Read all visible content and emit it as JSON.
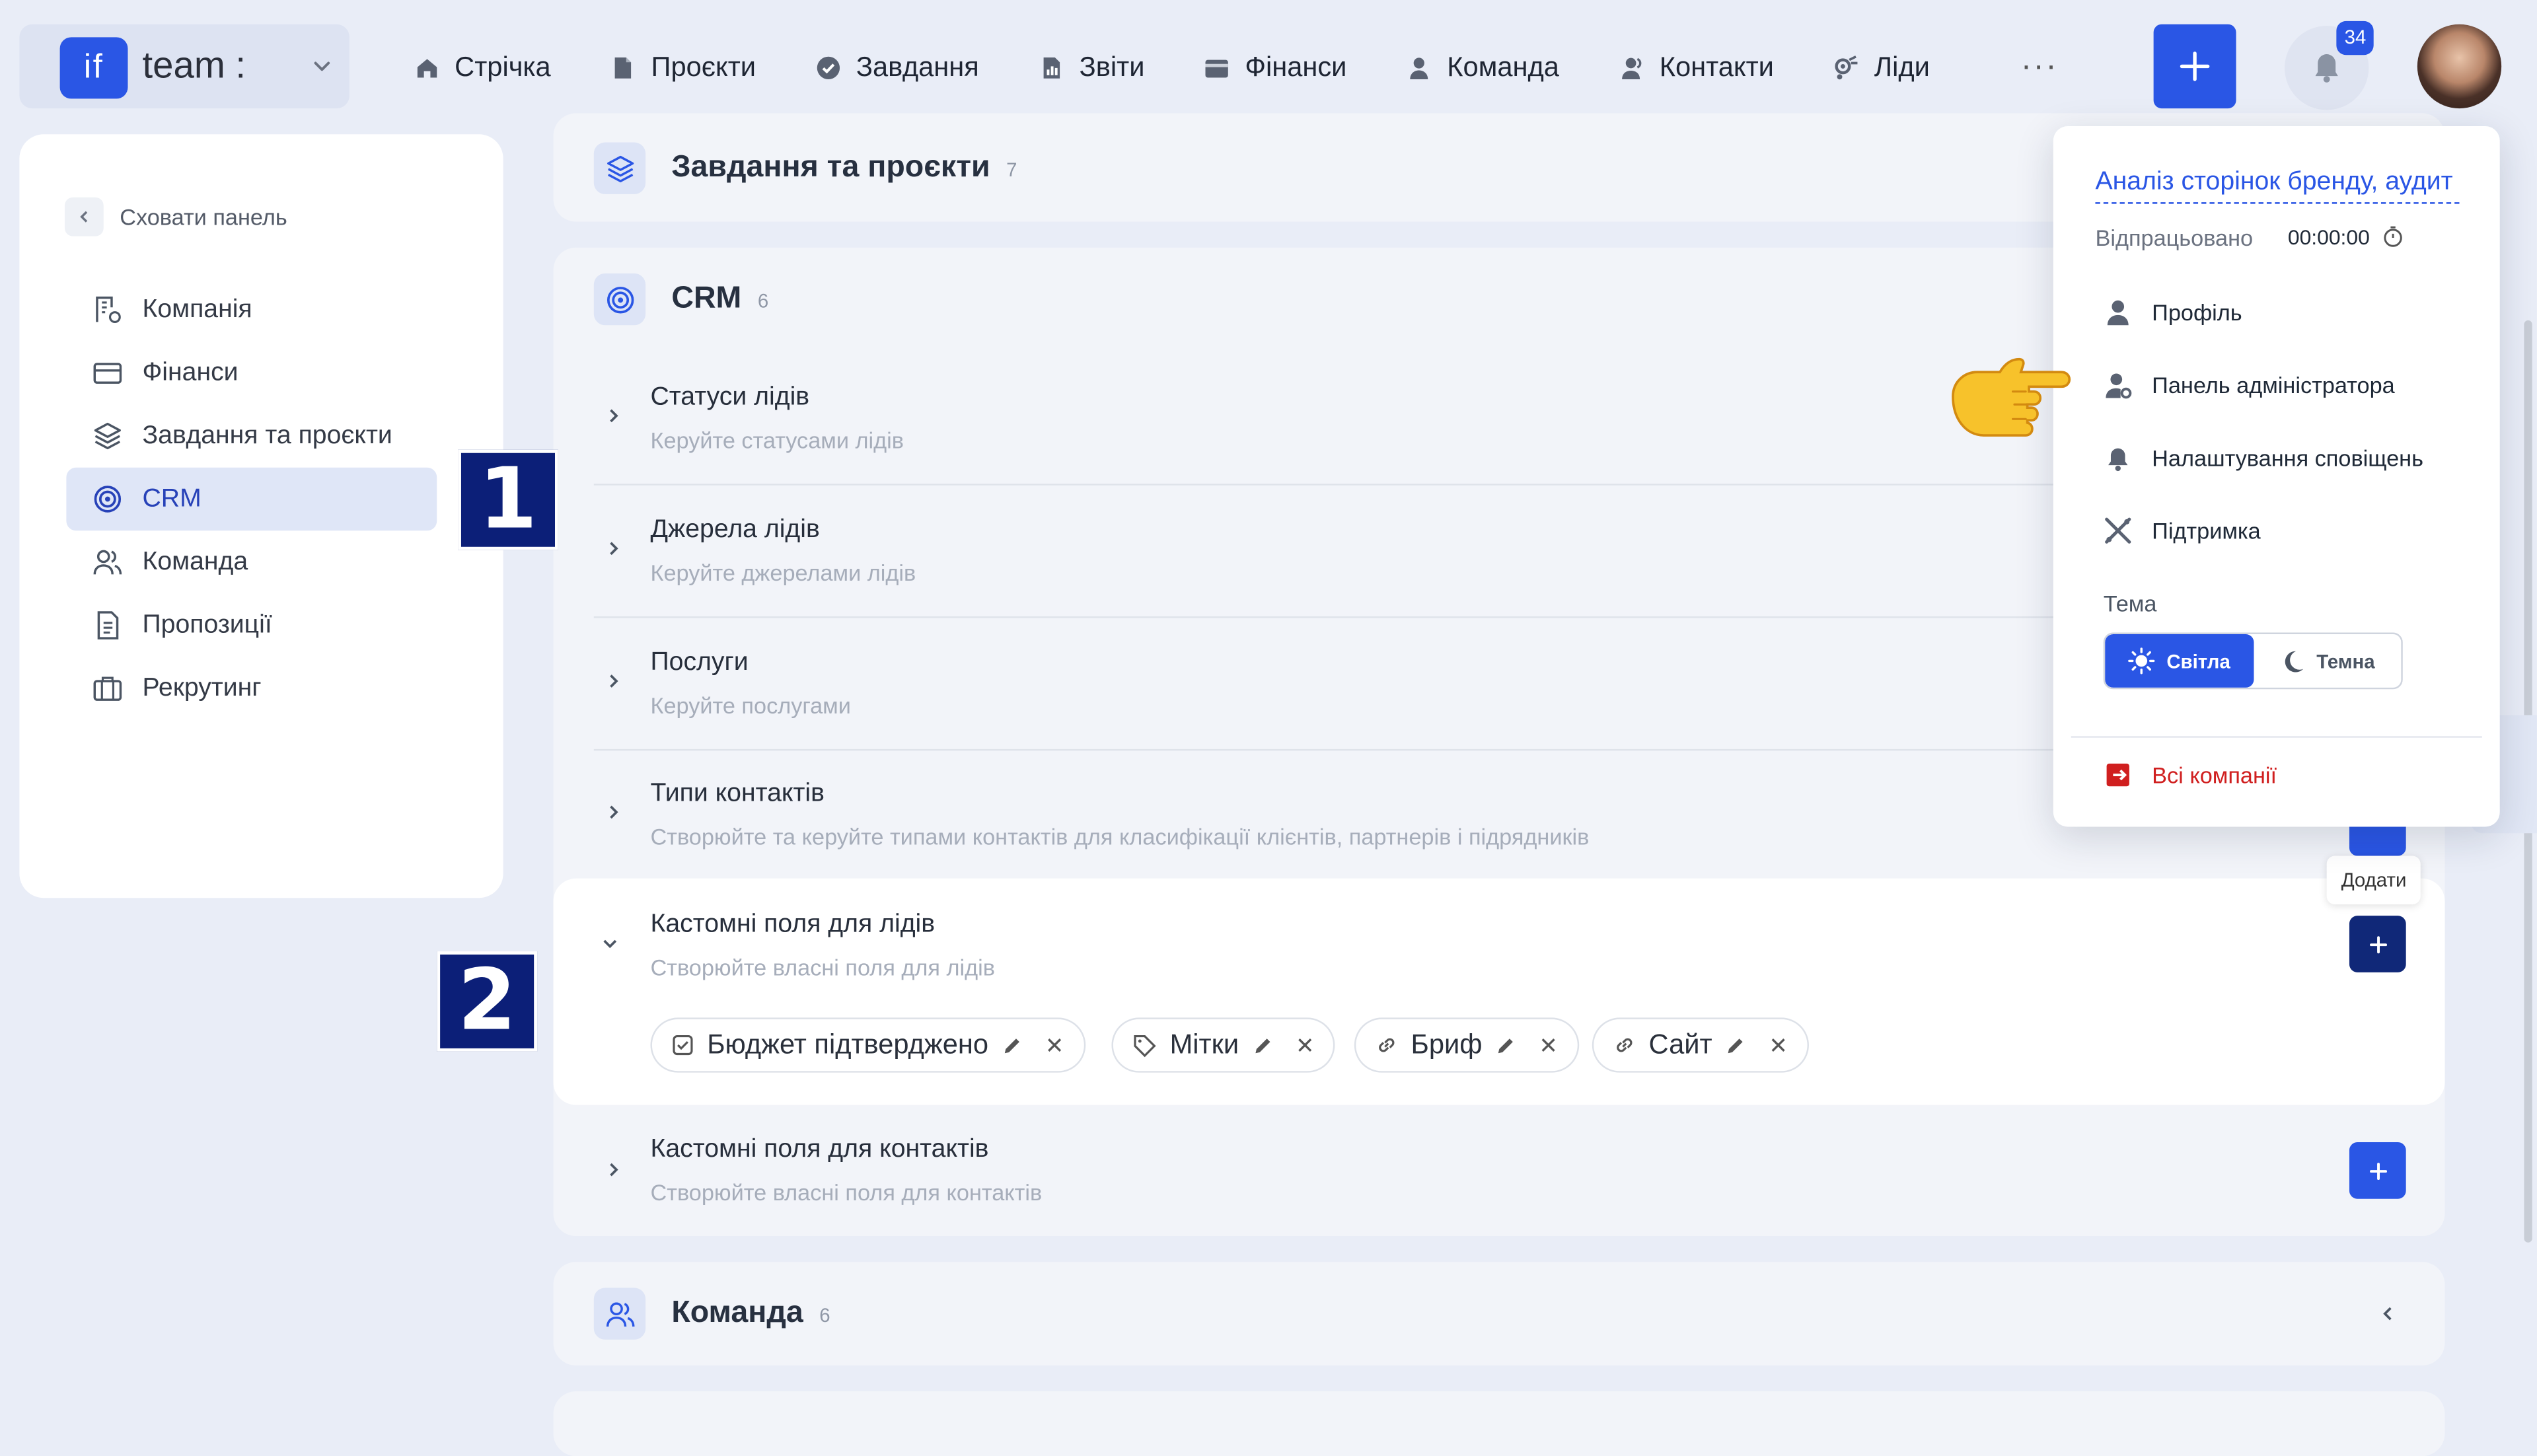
{
  "brand": {
    "logo": "if",
    "name": "team :"
  },
  "nav": [
    {
      "label": "Стрічка",
      "icon": "home-icon"
    },
    {
      "label": "Проєкти",
      "icon": "document-icon"
    },
    {
      "label": "Завдання",
      "icon": "check-circle-icon"
    },
    {
      "label": "Звіти",
      "icon": "report-icon"
    },
    {
      "label": "Фінанси",
      "icon": "wallet-icon"
    },
    {
      "label": "Команда",
      "icon": "person-icon"
    },
    {
      "label": "Контакти",
      "icon": "contacts-icon"
    },
    {
      "label": "Ліди",
      "icon": "leads-icon"
    }
  ],
  "nav_more": "···",
  "notifications": {
    "count": "34"
  },
  "sidebar": {
    "hide_label": "Сховати панель",
    "items": [
      {
        "label": "Компанія",
        "icon": "company-icon"
      },
      {
        "label": "Фінанси",
        "icon": "card-icon"
      },
      {
        "label": "Завдання та проєкти",
        "icon": "layers-icon"
      },
      {
        "label": "CRM",
        "icon": "target-icon",
        "active": true
      },
      {
        "label": "Команда",
        "icon": "team-icon"
      },
      {
        "label": "Пропозиції",
        "icon": "proposal-icon"
      },
      {
        "label": "Рекрутинг",
        "icon": "briefcase-icon"
      }
    ]
  },
  "sections": {
    "tasks": {
      "title": "Завдання та проєкти",
      "count": "7"
    },
    "crm": {
      "title": "CRM",
      "count": "6",
      "rows": [
        {
          "title": "Статуси лідів",
          "subtitle": "Керуйте статусами лідів"
        },
        {
          "title": "Джерела лідів",
          "subtitle": "Керуйте джерелами лідів"
        },
        {
          "title": "Послуги",
          "subtitle": "Керуйте послугами"
        },
        {
          "title": "Типи контактів",
          "subtitle": "Створюйте та керуйте типами контактів для класифікації клієнтів, партнерів і підрядників"
        },
        {
          "title": "Кастомні поля для лідів",
          "subtitle": "Створюйте власні поля для лідів",
          "expanded": true
        },
        {
          "title": "Кастомні поля для контактів",
          "subtitle": "Створюйте власні поля для контактів"
        }
      ],
      "chips": [
        {
          "label": "Бюджет підтверджено",
          "icon": "checkbox-icon"
        },
        {
          "label": "Мітки",
          "icon": "tag-icon"
        },
        {
          "label": "Бриф",
          "icon": "link-icon"
        },
        {
          "label": "Сайт",
          "icon": "link-icon"
        }
      ],
      "tooltip": "Додати"
    },
    "team": {
      "title": "Команда",
      "count": "6"
    }
  },
  "markers": {
    "one": "1",
    "two": "2"
  },
  "dropdown": {
    "task_title": "Аналіз сторінок бренду, аудит",
    "worked_label": "Відпрацьовано",
    "worked_time": "00:00:00",
    "items": [
      {
        "label": "Профіль",
        "icon": "person-icon"
      },
      {
        "label": "Панель адміністратора",
        "icon": "admin-icon"
      },
      {
        "label": "Налаштування сповіщень",
        "icon": "bell-icon"
      },
      {
        "label": "Підтримка",
        "icon": "tools-icon"
      }
    ],
    "theme_label": "Тема",
    "theme_light": "Світла",
    "theme_dark": "Темна",
    "all_companies": "Всі компанії"
  },
  "colors": {
    "accent": "#2a56e5",
    "marker": "#0c1f78",
    "danger": "#d01f1f",
    "background": "#e9edf7"
  }
}
